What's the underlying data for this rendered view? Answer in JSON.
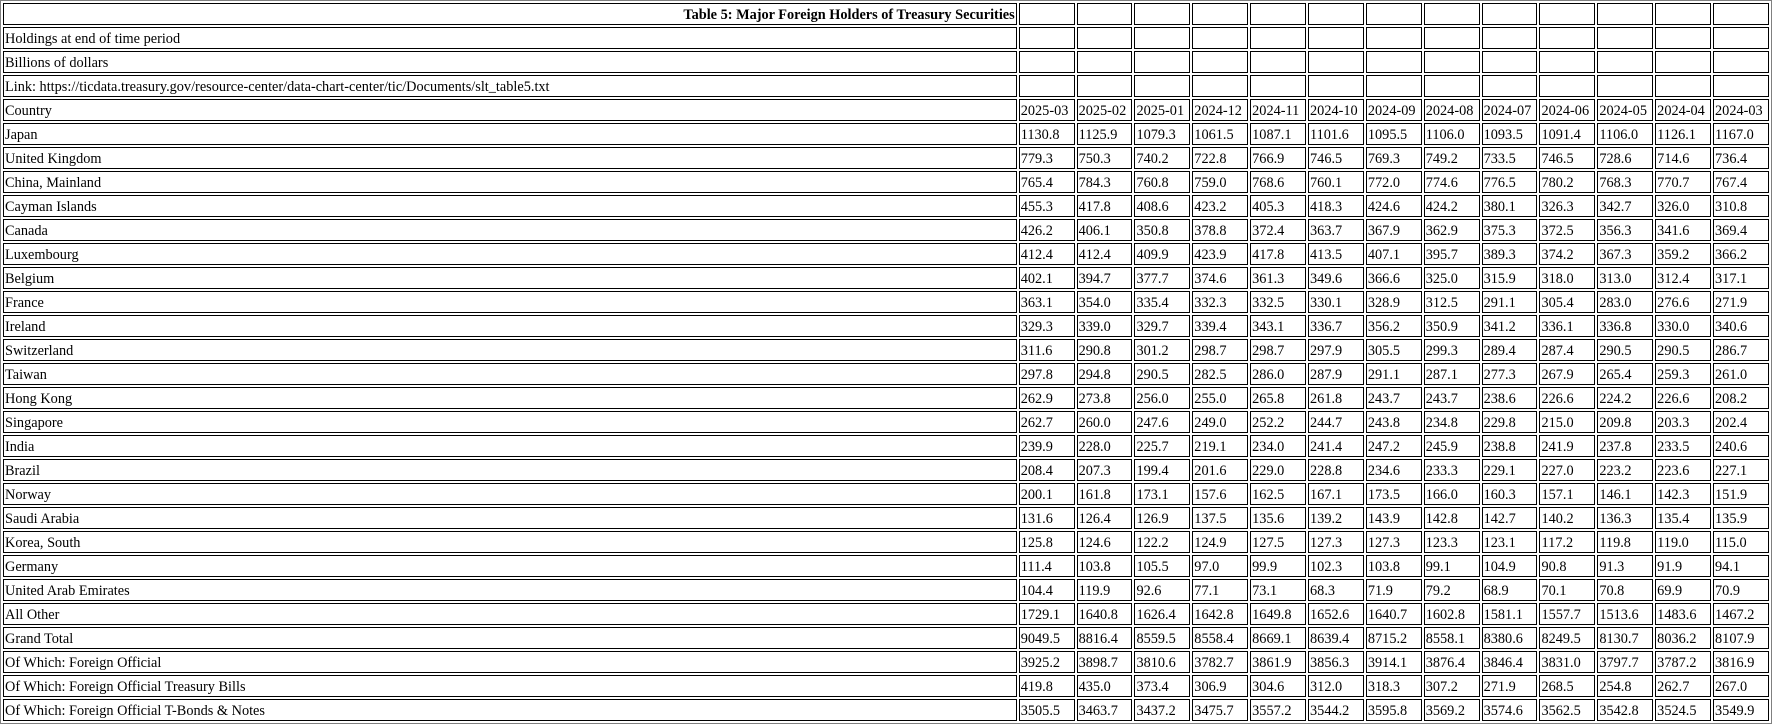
{
  "title": "Table 5: Major Foreign Holders of Treasury Securities",
  "notes": [
    "Holdings at end of time period",
    "Billions of dollars",
    "Link: https://ticdata.treasury.gov/resource-center/data-chart-center/tic/Documents/slt_table5.txt"
  ],
  "header_label": "Country",
  "periods": [
    "2025-03",
    "2025-02",
    "2025-01",
    "2024-12",
    "2024-11",
    "2024-10",
    "2024-09",
    "2024-08",
    "2024-07",
    "2024-06",
    "2024-05",
    "2024-04",
    "2024-03"
  ],
  "rows": [
    {
      "country": "Japan",
      "values": [
        "1130.8",
        "1125.9",
        "1079.3",
        "1061.5",
        "1087.1",
        "1101.6",
        "1095.5",
        "1106.0",
        "1093.5",
        "1091.4",
        "1106.0",
        "1126.1",
        "1167.0"
      ]
    },
    {
      "country": "United Kingdom",
      "values": [
        "779.3",
        "750.3",
        "740.2",
        "722.8",
        "766.9",
        "746.5",
        "769.3",
        "749.2",
        "733.5",
        "746.5",
        "728.6",
        "714.6",
        "736.4"
      ]
    },
    {
      "country": "China, Mainland",
      "values": [
        "765.4",
        "784.3",
        "760.8",
        "759.0",
        "768.6",
        "760.1",
        "772.0",
        "774.6",
        "776.5",
        "780.2",
        "768.3",
        "770.7",
        "767.4"
      ]
    },
    {
      "country": "Cayman Islands",
      "values": [
        "455.3",
        "417.8",
        "408.6",
        "423.2",
        "405.3",
        "418.3",
        "424.6",
        "424.2",
        "380.1",
        "326.3",
        "342.7",
        "326.0",
        "310.8"
      ]
    },
    {
      "country": "Canada",
      "values": [
        "426.2",
        "406.1",
        "350.8",
        "378.8",
        "372.4",
        "363.7",
        "367.9",
        "362.9",
        "375.3",
        "372.5",
        "356.3",
        "341.6",
        "369.4"
      ]
    },
    {
      "country": "Luxembourg",
      "values": [
        "412.4",
        "412.4",
        "409.9",
        "423.9",
        "417.8",
        "413.5",
        "407.1",
        "395.7",
        "389.3",
        "374.2",
        "367.3",
        "359.2",
        "366.2"
      ]
    },
    {
      "country": "Belgium",
      "values": [
        "402.1",
        "394.7",
        "377.7",
        "374.6",
        "361.3",
        "349.6",
        "366.6",
        "325.0",
        "315.9",
        "318.0",
        "313.0",
        "312.4",
        "317.1"
      ]
    },
    {
      "country": "France",
      "values": [
        "363.1",
        "354.0",
        "335.4",
        "332.3",
        "332.5",
        "330.1",
        "328.9",
        "312.5",
        "291.1",
        "305.4",
        "283.0",
        "276.6",
        "271.9"
      ]
    },
    {
      "country": "Ireland",
      "values": [
        "329.3",
        "339.0",
        "329.7",
        "339.4",
        "343.1",
        "336.7",
        "356.2",
        "350.9",
        "341.2",
        "336.1",
        "336.8",
        "330.0",
        "340.6"
      ]
    },
    {
      "country": "Switzerland",
      "values": [
        "311.6",
        "290.8",
        "301.2",
        "298.7",
        "298.7",
        "297.9",
        "305.5",
        "299.3",
        "289.4",
        "287.4",
        "290.5",
        "290.5",
        "286.7"
      ]
    },
    {
      "country": "Taiwan",
      "values": [
        "297.8",
        "294.8",
        "290.5",
        "282.5",
        "286.0",
        "287.9",
        "291.1",
        "287.1",
        "277.3",
        "267.9",
        "265.4",
        "259.3",
        "261.0"
      ]
    },
    {
      "country": "Hong Kong",
      "values": [
        "262.9",
        "273.8",
        "256.0",
        "255.0",
        "265.8",
        "261.8",
        "243.7",
        "243.7",
        "238.6",
        "226.6",
        "224.2",
        "226.6",
        "208.2"
      ]
    },
    {
      "country": "Singapore",
      "values": [
        "262.7",
        "260.0",
        "247.6",
        "249.0",
        "252.2",
        "244.7",
        "243.8",
        "234.8",
        "229.8",
        "215.0",
        "209.8",
        "203.3",
        "202.4"
      ]
    },
    {
      "country": "India",
      "values": [
        "239.9",
        "228.0",
        "225.7",
        "219.1",
        "234.0",
        "241.4",
        "247.2",
        "245.9",
        "238.8",
        "241.9",
        "237.8",
        "233.5",
        "240.6"
      ]
    },
    {
      "country": "Brazil",
      "values": [
        "208.4",
        "207.3",
        "199.4",
        "201.6",
        "229.0",
        "228.8",
        "234.6",
        "233.3",
        "229.1",
        "227.0",
        "223.2",
        "223.6",
        "227.1"
      ]
    },
    {
      "country": "Norway",
      "values": [
        "200.1",
        "161.8",
        "173.1",
        "157.6",
        "162.5",
        "167.1",
        "173.5",
        "166.0",
        "160.3",
        "157.1",
        "146.1",
        "142.3",
        "151.9"
      ]
    },
    {
      "country": "Saudi Arabia",
      "values": [
        "131.6",
        "126.4",
        "126.9",
        "137.5",
        "135.6",
        "139.2",
        "143.9",
        "142.8",
        "142.7",
        "140.2",
        "136.3",
        "135.4",
        "135.9"
      ]
    },
    {
      "country": "Korea, South",
      "values": [
        "125.8",
        "124.6",
        "122.2",
        "124.9",
        "127.5",
        "127.3",
        "127.3",
        "123.3",
        "123.1",
        "117.2",
        "119.8",
        "119.0",
        "115.0"
      ]
    },
    {
      "country": "Germany",
      "values": [
        "111.4",
        "103.8",
        "105.5",
        "97.0",
        "99.9",
        "102.3",
        "103.8",
        "99.1",
        "104.9",
        "90.8",
        "91.3",
        "91.9",
        "94.1"
      ]
    },
    {
      "country": "United Arab Emirates",
      "values": [
        "104.4",
        "119.9",
        "92.6",
        "77.1",
        "73.1",
        "68.3",
        "71.9",
        "79.2",
        "68.9",
        "70.1",
        "70.8",
        "69.9",
        "70.9"
      ]
    },
    {
      "country": "All Other",
      "values": [
        "1729.1",
        "1640.8",
        "1626.4",
        "1642.8",
        "1649.8",
        "1652.6",
        "1640.7",
        "1602.8",
        "1581.1",
        "1557.7",
        "1513.6",
        "1483.6",
        "1467.2"
      ]
    },
    {
      "country": "Grand Total",
      "values": [
        "9049.5",
        "8816.4",
        "8559.5",
        "8558.4",
        "8669.1",
        "8639.4",
        "8715.2",
        "8558.1",
        "8380.6",
        "8249.5",
        "8130.7",
        "8036.2",
        "8107.9"
      ]
    },
    {
      "country": "Of Which: Foreign Official",
      "values": [
        "3925.2",
        "3898.7",
        "3810.6",
        "3782.7",
        "3861.9",
        "3856.3",
        "3914.1",
        "3876.4",
        "3846.4",
        "3831.0",
        "3797.7",
        "3787.2",
        "3816.9"
      ]
    },
    {
      "country": "Of Which: Foreign Official Treasury Bills",
      "values": [
        "419.8",
        "435.0",
        "373.4",
        "306.9",
        "304.6",
        "312.0",
        "318.3",
        "307.2",
        "271.9",
        "268.5",
        "254.8",
        "262.7",
        "267.0"
      ]
    },
    {
      "country": "Of Which: Foreign Official T-Bonds & Notes",
      "values": [
        "3505.5",
        "3463.7",
        "3437.2",
        "3475.7",
        "3557.2",
        "3544.2",
        "3595.8",
        "3569.2",
        "3574.6",
        "3562.5",
        "3542.8",
        "3524.5",
        "3549.9"
      ]
    }
  ]
}
